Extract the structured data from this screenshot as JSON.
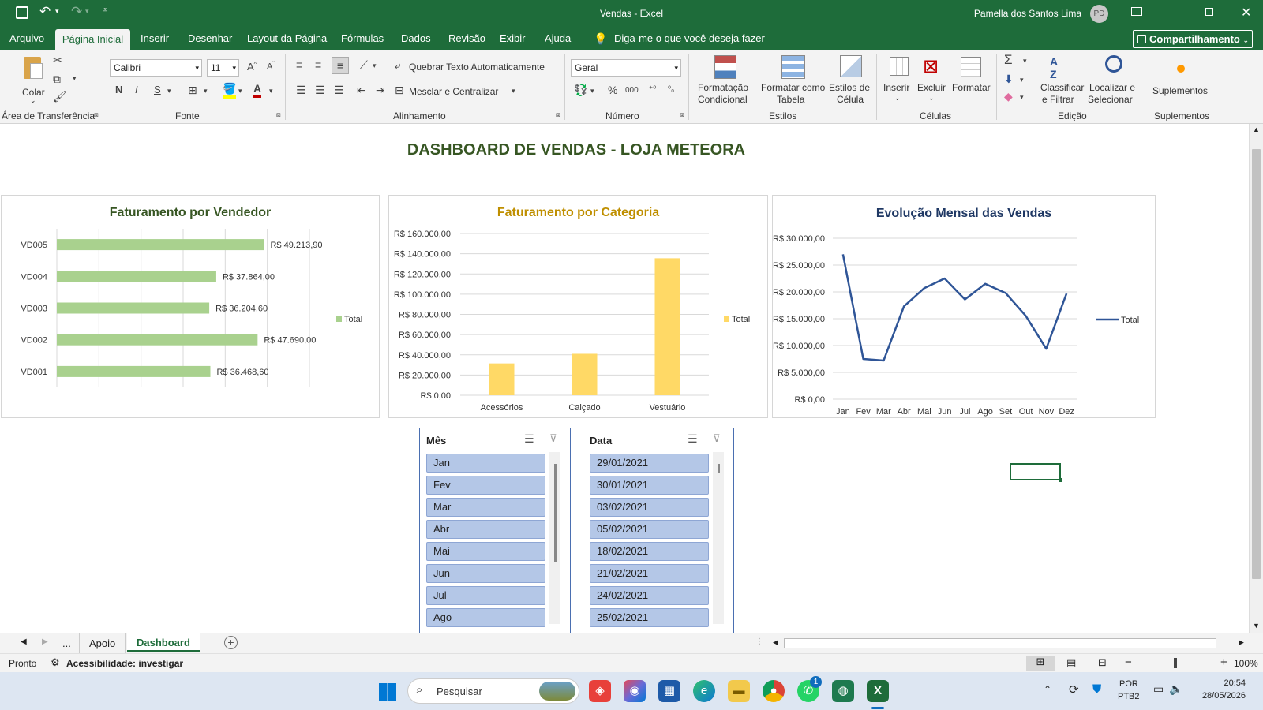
{
  "window": {
    "title": "Vendas  -  Excel",
    "user": "Pamella dos Santos Lima",
    "user_initials": "PD"
  },
  "tabs": [
    "Arquivo",
    "Página Inicial",
    "Inserir",
    "Desenhar",
    "Layout da Página",
    "Fórmulas",
    "Dados",
    "Revisão",
    "Exibir",
    "Ajuda"
  ],
  "tell_me": "Diga-me o que você deseja fazer",
  "share_label": "Compartilhamento",
  "ribbon": {
    "paste_label": "Colar",
    "clipboard_group": "Área de Transferência",
    "font_name": "Calibri",
    "font_size": "11",
    "font_group": "Fonte",
    "bold": "N",
    "italic": "I",
    "underline": "S",
    "wrap_text": "Quebrar Texto Automaticamente",
    "merge_center": "Mesclar e Centralizar",
    "alignment_group": "Alinhamento",
    "number_format": "Geral",
    "number_group": "Número",
    "cond_format_1": "Formatação",
    "cond_format_2": "Condicional",
    "format_table_1": "Formatar como",
    "format_table_2": "Tabela",
    "cell_styles_1": "Estilos de",
    "cell_styles_2": "Célula",
    "styles_group": "Estilos",
    "insert": "Inserir",
    "delete": "Excluir",
    "format": "Formatar",
    "cells_group": "Células",
    "sort_filter_1": "Classificar",
    "sort_filter_2": "e Filtrar",
    "find_select_1": "Localizar e",
    "find_select_2": "Selecionar",
    "editing_group": "Edição",
    "addins": "Suplementos",
    "addins_group": "Suplementos"
  },
  "dashboard_title": "DASHBOARD DE VENDAS - LOJA METEORA",
  "colors": {
    "excel_green": "#1e6c3a",
    "bar_green": "#a9d18e",
    "bar_yellow": "#ffd966",
    "line_blue": "#2f5597",
    "title_green": "#375623",
    "title_gold": "#bf8f00",
    "title_blue": "#1f3864",
    "slicer_item": "#b4c7e7"
  },
  "chart_data": [
    {
      "type": "bar",
      "orientation": "horizontal",
      "title": "Faturamento por Vendedor",
      "categories": [
        "VD005",
        "VD004",
        "VD003",
        "VD002",
        "VD001"
      ],
      "values": [
        49213.9,
        37864.0,
        36204.6,
        47690.0,
        36468.6
      ],
      "data_labels": [
        "R$ 49.213,90",
        "R$ 37.864,00",
        "R$ 36.204,60",
        "R$ 47.690,00",
        "R$ 36.468,60"
      ],
      "xlim": [
        0,
        60000
      ],
      "legend": "Total",
      "legend_position": "right",
      "grid": true
    },
    {
      "type": "bar",
      "title": "Faturamento por Categoria",
      "categories": [
        "Acessórios",
        "Calçado",
        "Vestuário"
      ],
      "values": [
        31500,
        41000,
        135500
      ],
      "ylim": [
        0,
        160000
      ],
      "yticks": [
        "R$ 0,00",
        "R$ 20.000,00",
        "R$ 40.000,00",
        "R$ 60.000,00",
        "R$ 80.000,00",
        "R$ 100.000,00",
        "R$ 120.000,00",
        "R$ 140.000,00",
        "R$ 160.000,00"
      ],
      "legend": "Total",
      "legend_position": "right",
      "grid": true
    },
    {
      "type": "line",
      "title": "Evolução Mensal das Vendas",
      "categories": [
        "Jan",
        "Fev",
        "Mar",
        "Abr",
        "Mai",
        "Jun",
        "Jul",
        "Ago",
        "Set",
        "Out",
        "Nov",
        "Dez"
      ],
      "values": [
        27000,
        7500,
        7200,
        17300,
        20700,
        22500,
        18600,
        21500,
        19800,
        15500,
        9400,
        19700
      ],
      "ylim": [
        0,
        30000
      ],
      "yticks": [
        "R$ 0,00",
        "R$ 5.000,00",
        "R$ 10.000,00",
        "R$ 15.000,00",
        "R$ 20.000,00",
        "R$ 25.000,00",
        "R$ 30.000,00"
      ],
      "legend": "Total",
      "legend_position": "right",
      "grid": true
    }
  ],
  "slicers": [
    {
      "header": "Mês",
      "items": [
        "Jan",
        "Fev",
        "Mar",
        "Abr",
        "Mai",
        "Jun",
        "Jul",
        "Ago"
      ]
    },
    {
      "header": "Data",
      "items": [
        "29/01/2021",
        "30/01/2021",
        "03/02/2021",
        "05/02/2021",
        "18/02/2021",
        "21/02/2021",
        "24/02/2021",
        "25/02/2021"
      ]
    }
  ],
  "sheet_tabs": {
    "more": "...",
    "tab1": "Apoio",
    "tab2": "Dashboard"
  },
  "status": {
    "ready": "Pronto",
    "accessibility": "Acessibilidade: investigar",
    "zoom": "100%"
  },
  "taskbar": {
    "search": "Pesquisar",
    "lang1": "POR",
    "lang2": "PTB2",
    "time": "20:54",
    "date": "28/05/2026",
    "whatsapp_badge": "1"
  }
}
